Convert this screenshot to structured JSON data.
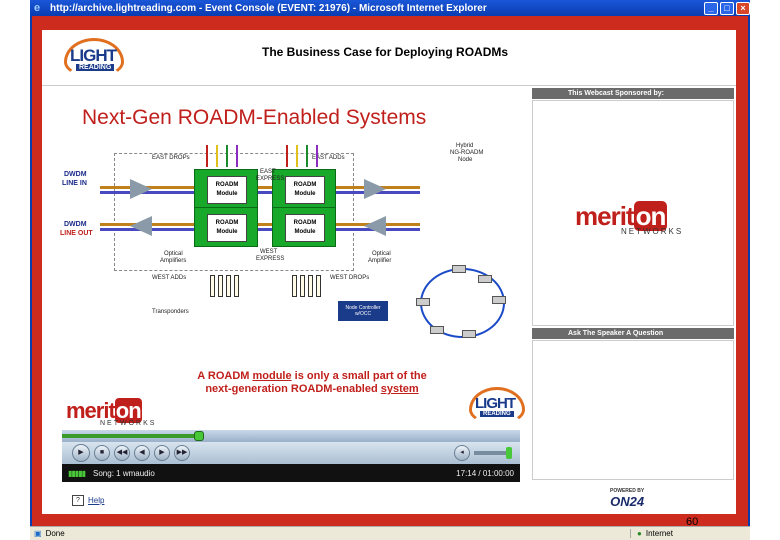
{
  "window": {
    "title": "http://archive.lightreading.com - Event Console (EVENT: 21976) - Microsoft Internet Explorer",
    "minimize": "_",
    "maximize": "□",
    "close": "×"
  },
  "header": {
    "logo_text": "LIGHT",
    "logo_subtext": "READING",
    "webcast_title": "The Business Case for Deploying ROADMs"
  },
  "slide": {
    "title": "Next-Gen ROADM-Enabled Systems",
    "labels": {
      "east_drops": "EAST DROPs",
      "east_adds": "EAST ADDs",
      "hybrid_node": "Hybrid",
      "hybrid_node_2": "NG-ROADM",
      "hybrid_node_3": "Node",
      "dwdm_line_in_1": "DWDM",
      "dwdm_line_in_2": "LINE IN",
      "dwdm_line_out_1": "DWDM",
      "dwdm_line_out_2": "LINE OUT",
      "east_express_1": "EAST",
      "east_express_2": "EXPRESS",
      "west_express_1": "WEST",
      "west_express_2": "EXPRESS",
      "roadm_module": "ROADM",
      "module": "Module",
      "optical_amp_left_1": "Optical",
      "optical_amp_left_2": "Amplifiers",
      "optical_amp_right_1": "Optical",
      "optical_amp_right_2": "Amplifier",
      "west_adds": "WEST ADDs",
      "west_drops": "WEST DROPs",
      "transponders": "Transponders",
      "node_controller": "Node Controller w/OCC"
    },
    "caption_a": "A ROADM ",
    "caption_module": "module",
    "caption_b": " is only a small part of the",
    "caption_c": "next-generation ROADM-enabled ",
    "caption_system": "system",
    "meriton_text": "merit",
    "meriton_on": "on",
    "networks_text": "NETWORKS"
  },
  "player": {
    "progress": 0.3,
    "play_icon": "▶",
    "stop_icon": "■",
    "prev_icon": "◀◀",
    "rew_icon": "◀",
    "fwd_icon": "▶",
    "next_icon": "▶▶",
    "mute_icon": "◂",
    "song": "Song: 1 wmaudio",
    "time": "17:14 / 01:00:00",
    "bars": "▮▮▮▮▮"
  },
  "right": {
    "sponsor_header": "This Webcast Sponsored by:",
    "meriton_text": "merit",
    "meriton_on": "on",
    "networks_text": "NETWORKS",
    "ask_header": "Ask The Speaker A Question"
  },
  "footer": {
    "help": "Help",
    "help_icon": "?",
    "powered_by": "POWERED BY",
    "on24": "ON24"
  },
  "statusbar": {
    "done": "Done",
    "zone": "Internet"
  },
  "slide_number": "60"
}
